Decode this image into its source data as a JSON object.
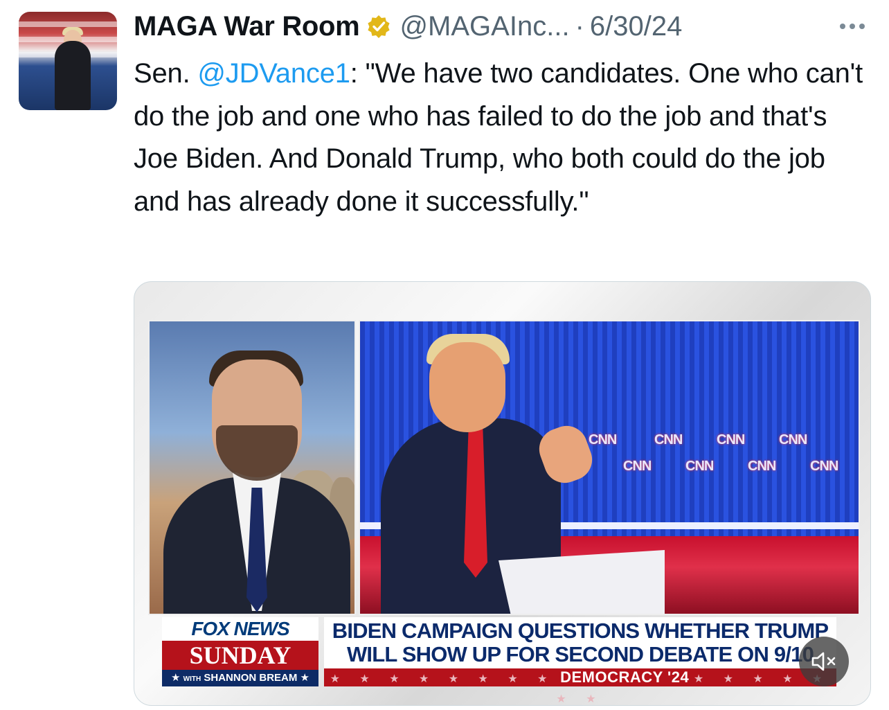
{
  "tweet": {
    "author_name": "MAGA War Room",
    "handle": "@MAGAInc...",
    "separator": "·",
    "date": "6/30/24",
    "text": {
      "prefix": "Sen. ",
      "mention": "@JDVance1",
      "body": ": \"We have two candidates. One who can't do the job and one who has failed to do the job and that's Joe Biden. And Donald Trump, who both could do the job and has already done it successfully.\""
    }
  },
  "media": {
    "brand": {
      "top": "FOX NEWS",
      "middle": "SUNDAY",
      "bottom_small": "WITH",
      "bottom": "SHANNON BREAM",
      "star": "★"
    },
    "chyron": {
      "line1": "BIDEN CAMPAIGN QUESTIONS WHETHER TRUMP",
      "line2": "WILL SHOW UP FOR SECOND DEBATE ON 9/10",
      "sub": "DEMOCRACY '24",
      "stars_left": "★ ★ ★ ★ ★ ★ ★ ★",
      "stars_right": "★ ★ ★ ★ ★ ★ ★"
    },
    "backdrop_text": "CNN",
    "colors": {
      "fox_blue": "#003b7a",
      "fox_red": "#b5121b",
      "cnn_blue": "#2a52e0"
    }
  },
  "icons": {
    "verified": "verified-badge-icon",
    "more": "more-dots-icon",
    "mute": "speaker-muted-icon"
  }
}
